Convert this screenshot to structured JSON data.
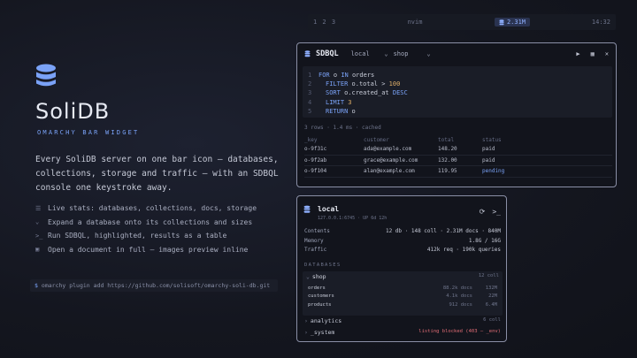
{
  "topbar": {
    "workspaces": "1 2 3",
    "app": "nvim",
    "docs_pill": "2.31M",
    "clock": "14:32"
  },
  "hero": {
    "title": "SoliDB",
    "subtitle": "OMARCHY BAR WIDGET",
    "description": "Every SoliDB server on one bar icon — databases, collections, storage and traffic — with an SDBQL console one keystroke away.",
    "features": [
      {
        "icon": "stats-icon",
        "glyph": "☰",
        "text": "Live stats: databases, collections, docs, storage"
      },
      {
        "icon": "chevron-down-icon",
        "glyph": "⌄",
        "text": "Expand a database onto its collections and sizes"
      },
      {
        "icon": "terminal-icon",
        "glyph": ">_",
        "text": "Run SDBQL, highlighted, results as a table"
      },
      {
        "icon": "image-icon",
        "glyph": "▣",
        "text": "Open a document in full — images preview inline"
      }
    ],
    "install_prompt": "$",
    "install_cmd": "omarchy plugin add https://github.com/solisoft/omarchy-soli-db.git"
  },
  "sdbql": {
    "title": "SDBQL",
    "server": "local",
    "database": "shop",
    "code": [
      {
        "n": "1",
        "indent": false,
        "parts": [
          [
            "kw",
            "FOR"
          ],
          [
            "t",
            " o "
          ],
          [
            "kw",
            "IN"
          ],
          [
            "t",
            " orders"
          ]
        ]
      },
      {
        "n": "2",
        "indent": true,
        "parts": [
          [
            "kw",
            "FILTER"
          ],
          [
            "t",
            " o.total > "
          ],
          [
            "num",
            "100"
          ]
        ]
      },
      {
        "n": "3",
        "indent": true,
        "parts": [
          [
            "kw",
            "SORT"
          ],
          [
            "t",
            " o.created_at "
          ],
          [
            "kw",
            "DESC"
          ]
        ]
      },
      {
        "n": "4",
        "indent": true,
        "parts": [
          [
            "kw",
            "LIMIT"
          ],
          [
            "t",
            " "
          ],
          [
            "num",
            "3"
          ]
        ]
      },
      {
        "n": "5",
        "indent": true,
        "parts": [
          [
            "kw",
            "RETURN"
          ],
          [
            "t",
            " o"
          ]
        ]
      }
    ],
    "meta": "3 rows · 1.4 ms · cached",
    "columns": [
      "_key",
      "customer",
      "total",
      "status"
    ],
    "rows": [
      [
        "o-9f31c",
        "ada@example.com",
        "148.20",
        "paid"
      ],
      [
        "o-9f2ab",
        "grace@example.com",
        "132.00",
        "paid"
      ],
      [
        "o-9f104",
        "alan@example.com",
        "119.95",
        "pending"
      ]
    ]
  },
  "local": {
    "name": "local",
    "address": "127.0.0.1:6745 · UP 6d 12h",
    "stats": [
      {
        "label": "Contents",
        "value": "12 db · 148 coll · 2.31M docs · 840M"
      },
      {
        "label": "Memory",
        "value": "1.8G / 16G"
      },
      {
        "label": "Traffic",
        "value": "412k req · 190k queries"
      }
    ],
    "databases_label": "DATABASES",
    "shop": {
      "name": "shop",
      "count": "12 coll",
      "collections": [
        {
          "name": "orders",
          "docs": "88.2k docs",
          "size": "132M"
        },
        {
          "name": "customers",
          "docs": "4.1k docs",
          "size": "22M"
        },
        {
          "name": "products",
          "docs": "912 docs",
          "size": "6.4M"
        }
      ]
    },
    "analytics": {
      "name": "analytics",
      "count": "6 coll"
    },
    "system": {
      "name": "_system",
      "error": "listing blocked (403 — _env)"
    }
  }
}
